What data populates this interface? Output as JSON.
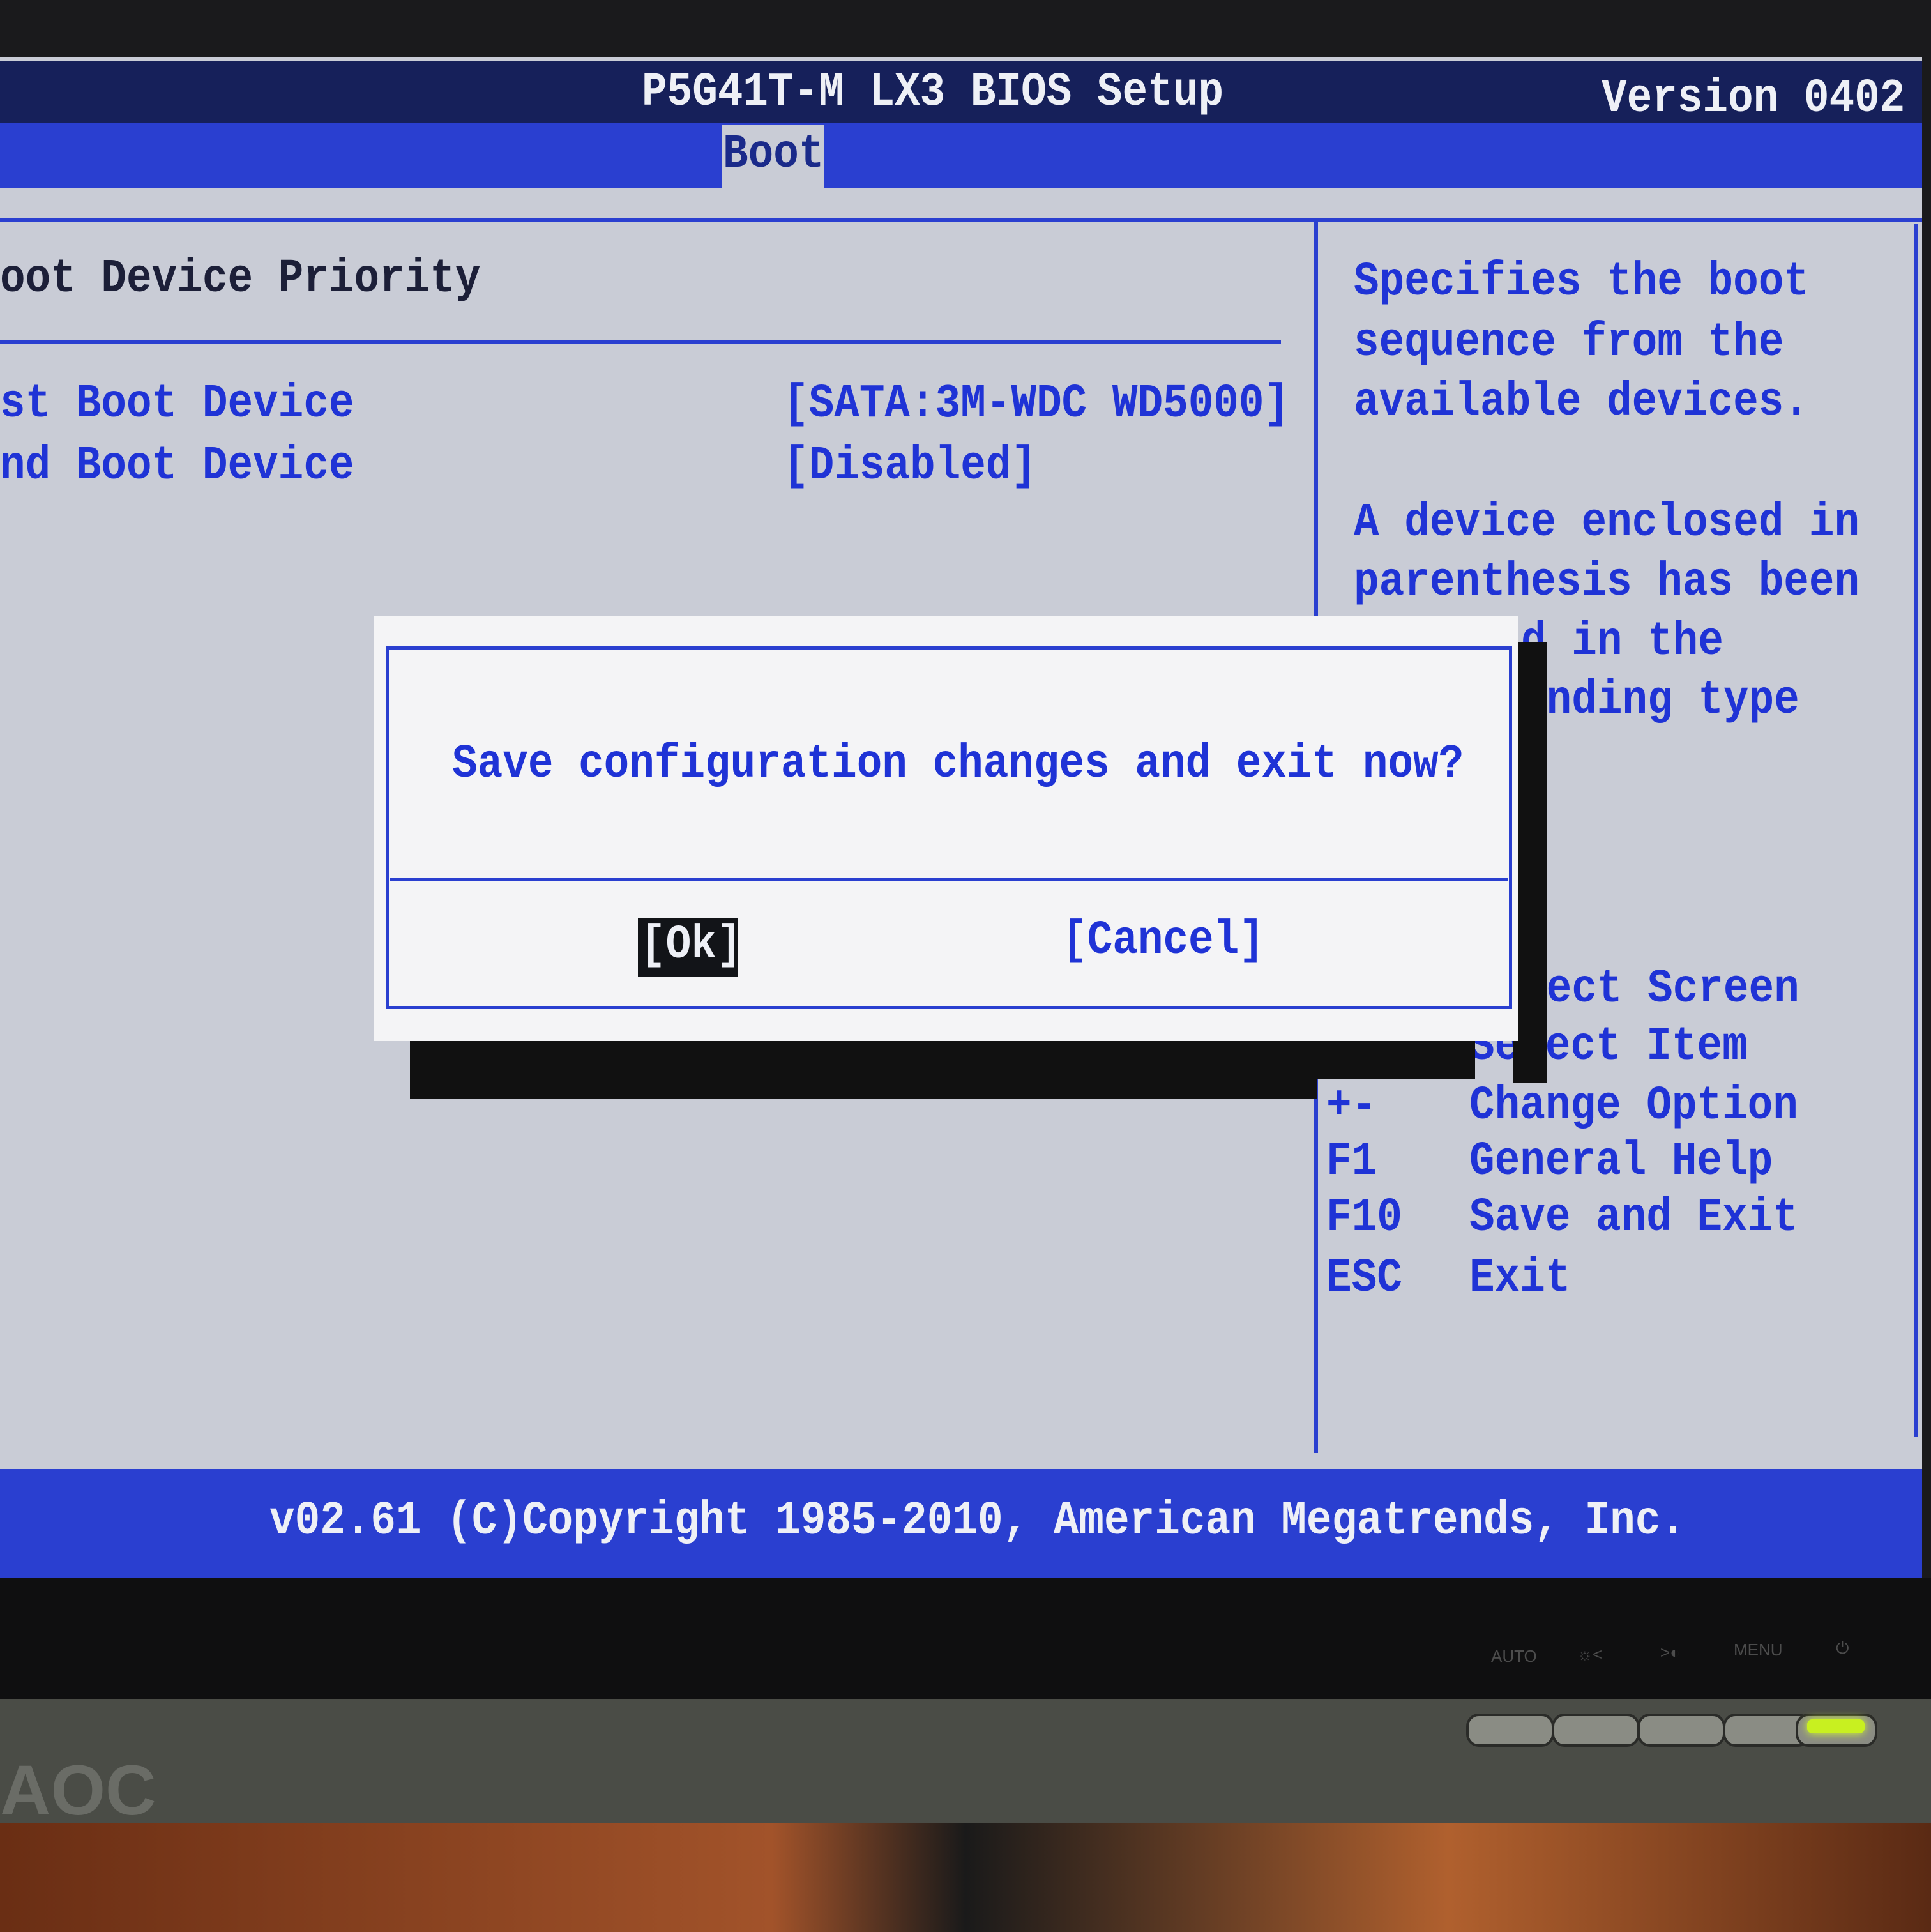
{
  "header": {
    "title": "P5G41T-M LX3 BIOS Setup",
    "version": "Version 0402"
  },
  "tabs": [
    {
      "label": "Boot",
      "active": true
    }
  ],
  "main": {
    "section_title": "oot Device Priority",
    "items": [
      {
        "label": "st Boot Device",
        "value": "[SATA:3M-WDC WD5000]"
      },
      {
        "label": "nd Boot Device",
        "value": "[Disabled]"
      }
    ]
  },
  "help": {
    "lines": [
      "Specifies the boot",
      "sequence from the",
      "available devices.",
      "A device enclosed in",
      "parenthesis has been",
      "d in the",
      "onding type"
    ]
  },
  "keys": [
    {
      "key": "",
      "desc": "lect Screen"
    },
    {
      "key": "↑↓",
      "desc": "Select Item"
    },
    {
      "key": "+-",
      "desc": "Change Option"
    },
    {
      "key": "F1",
      "desc": "General Help"
    },
    {
      "key": "F10",
      "desc": "Save and Exit"
    },
    {
      "key": "ESC",
      "desc": "Exit"
    }
  ],
  "dialog": {
    "message": "Save configuration changes and exit now?",
    "ok_label": "[Ok]",
    "cancel_label": "[Cancel]"
  },
  "footer": {
    "copyright": "v02.61 (C)Copyright 1985-2010, American Megatrends, Inc."
  },
  "monitor": {
    "brand": "AOC",
    "buttons": [
      "AUTO",
      "☼<",
      ">◐",
      "MENU",
      "⏻"
    ]
  },
  "colors": {
    "accent": "#2a3fd0",
    "text_blue": "#1f33d6",
    "header": "#16205a",
    "background": "#c9ccd6"
  }
}
